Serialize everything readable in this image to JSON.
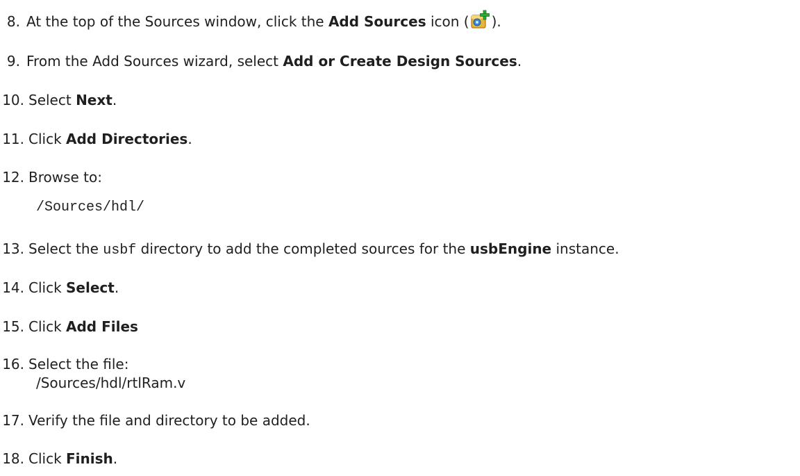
{
  "steps": [
    {
      "num": "8.",
      "pre": "At the top of the Sources window, click the ",
      "bold": "Add Sources",
      "mid": " icon (",
      "post": ")."
    },
    {
      "num": "9.",
      "pre": "From the Add Sources wizard, select ",
      "bold": "Add or Create Design Sources",
      "post": "."
    },
    {
      "num": "10.",
      "pre": "Select ",
      "bold": "Next",
      "post": "."
    },
    {
      "num": "11.",
      "pre": "Click ",
      "bold": "Add Directories",
      "post": "."
    },
    {
      "num": "12.",
      "pre": "Browse to:",
      "code": "/Sources/hdl/"
    },
    {
      "num": "13.",
      "pre": "Select the ",
      "code": "usbf",
      "mid": " directory to add the completed sources for the ",
      "bold": "usbEngine",
      "post": " instance."
    },
    {
      "num": "14.",
      "pre": "Click ",
      "bold": "Select",
      "post": "."
    },
    {
      "num": "15.",
      "pre": "Click ",
      "bold": "Add Files"
    },
    {
      "num": "16.",
      "pre": "Select the file:",
      "sub": "/Sources/hdl/rtlRam.v"
    },
    {
      "num": "17.",
      "pre": "Verify the file and directory to be added."
    },
    {
      "num": "18.",
      "pre": "Click ",
      "bold": "Finish",
      "post": "."
    }
  ],
  "icons": {
    "add_sources": "add-sources-icon",
    "colors": {
      "box": "#e8b53a",
      "box_dark": "#b07a12",
      "plus": "#2fa836",
      "plus_dark": "#13761c",
      "circle": "#3a86d1"
    }
  }
}
